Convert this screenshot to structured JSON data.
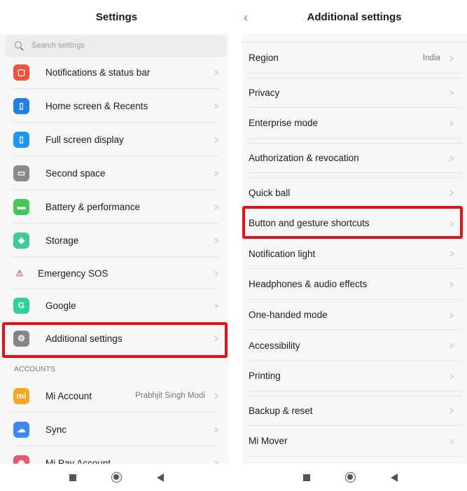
{
  "left": {
    "title": "Settings",
    "search_placeholder": "Search settings",
    "items": [
      {
        "label": "Notifications & status bar",
        "icon": "notification-icon",
        "color": "#f0533c"
      },
      {
        "label": "Home screen & Recents",
        "icon": "home-screen-icon",
        "color": "#1f80e8"
      },
      {
        "label": "Full screen display",
        "icon": "full-screen-icon",
        "color": "#2196f0"
      },
      {
        "label": "Second space",
        "icon": "second-space-icon",
        "color": "#8a8a8e"
      },
      {
        "label": "Battery & performance",
        "icon": "battery-icon",
        "color": "#44c75a"
      },
      {
        "label": "Storage",
        "icon": "storage-icon",
        "color": "#3ccc94"
      },
      {
        "label": "Emergency SOS",
        "icon": "sos-icon",
        "color": "#e35a6d"
      },
      {
        "label": "Google",
        "icon": "google-icon",
        "color": "#2fd19a"
      },
      {
        "label": "Additional settings",
        "icon": "gear-icon",
        "color": "#85858a"
      }
    ],
    "accounts_header": "ACCOUNTS",
    "accounts": [
      {
        "label": "Mi Account",
        "value": "Prabhjit Singh Modi",
        "icon": "mi-account-icon",
        "color": "#f5a623"
      },
      {
        "label": "Sync",
        "icon": "cloud-icon",
        "color": "#3e87f0"
      },
      {
        "label": "Mi Pay Account",
        "icon": "mi-pay-icon",
        "color": "#e35a6d"
      }
    ]
  },
  "right": {
    "title": "Additional settings",
    "items": [
      {
        "label": "Region",
        "value": "India"
      },
      {
        "label": "Privacy"
      },
      {
        "label": "Enterprise mode"
      },
      {
        "label": "Authorization & revocation"
      },
      {
        "label": "Quick ball"
      },
      {
        "label": "Button and gesture shortcuts"
      },
      {
        "label": "Notification light"
      },
      {
        "label": "Headphones & audio effects"
      },
      {
        "label": "One-handed mode"
      },
      {
        "label": "Accessibility"
      },
      {
        "label": "Printing"
      },
      {
        "label": "Backup & reset"
      },
      {
        "label": "Mi Mover"
      }
    ]
  },
  "highlight_color": "#e3111b"
}
